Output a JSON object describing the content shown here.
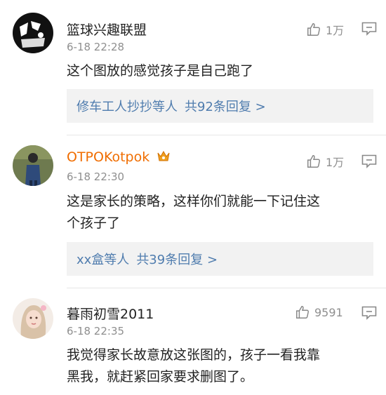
{
  "comments": [
    {
      "username": "篮球兴趣联盟",
      "time": "6-18 22:28",
      "likes": "1万",
      "text": "这个图放的感觉孩子是自己跑了",
      "reply_users": "修车工人抄抄等人",
      "reply_count": "共92条回复 >"
    },
    {
      "username": "OTPOKotpok",
      "time": "6-18 22:30",
      "likes": "1万",
      "text_line1": "这是家长的策略，这样你们就能一下记住这",
      "text_line2": "个孩子了",
      "reply_users": "xx盒等人",
      "reply_count": "共39条回复 >"
    },
    {
      "username": "暮雨初雪2011",
      "time": "6-18 22:35",
      "likes": "9591",
      "text_line1": "我觉得家长故意放这张图的，孩子一看我靠",
      "text_line2": "黑我，就赶紧回家要求删图了。"
    }
  ],
  "colors": {
    "vip_name": "#f06d00",
    "reply_link": "#4f7cae",
    "meta_gray": "#8f8f8f"
  }
}
